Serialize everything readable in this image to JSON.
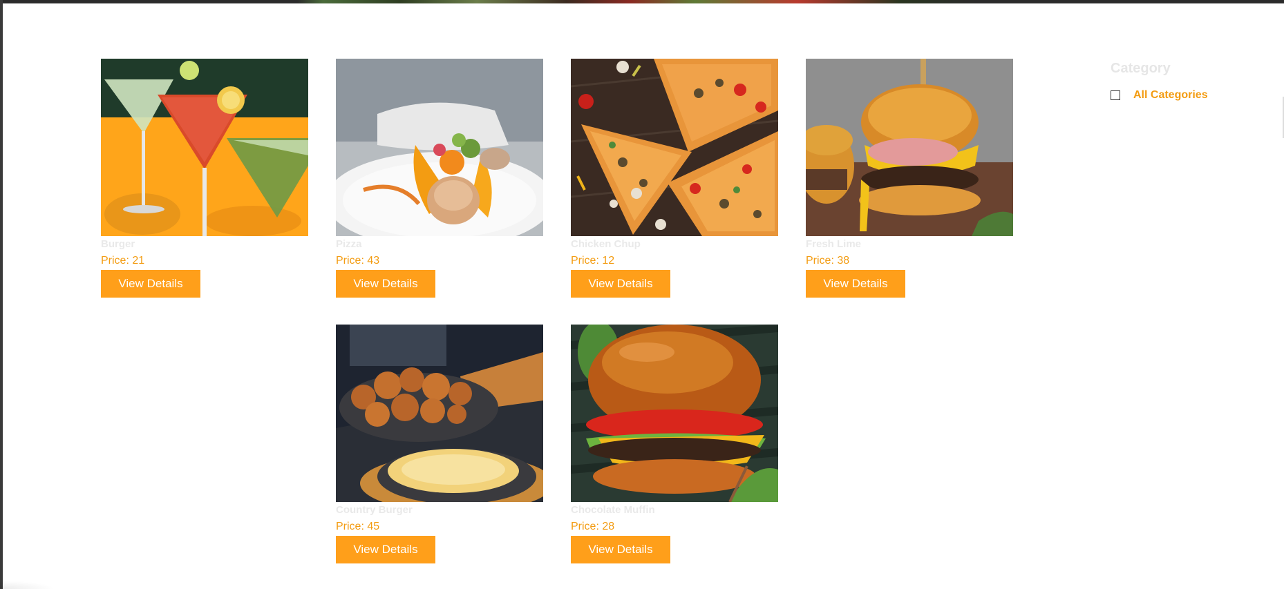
{
  "products": [
    {
      "name": "Burger",
      "price": "Price: 21",
      "button": "View Details",
      "image": "cocktails-photo"
    },
    {
      "name": "Pizza",
      "price": "Price: 43",
      "button": "View Details",
      "image": "plated-fish-photo"
    },
    {
      "name": "Chicken Chup",
      "price": "Price: 12",
      "button": "View Details",
      "image": "pizza-slices-photo"
    },
    {
      "name": "Fresh Lime",
      "price": "Price: 38",
      "button": "View Details",
      "image": "cheese-burger-photo"
    },
    {
      "name": "Country Burger",
      "price": "Price: 45",
      "button": "View Details",
      "image": "fried-chicken-corn-photo"
    },
    {
      "name": "Chocolate Muffin",
      "price": "Price: 28",
      "button": "View Details",
      "image": "classic-burger-photo"
    }
  ],
  "sidebar": {
    "heading": "Category",
    "categories": [
      {
        "label": "All Categories",
        "checked": false
      }
    ]
  },
  "colors": {
    "accent": "#ff9f1a",
    "price": "#f39c12",
    "title": "#e9e9e9",
    "heading": "#e6e6e6"
  }
}
